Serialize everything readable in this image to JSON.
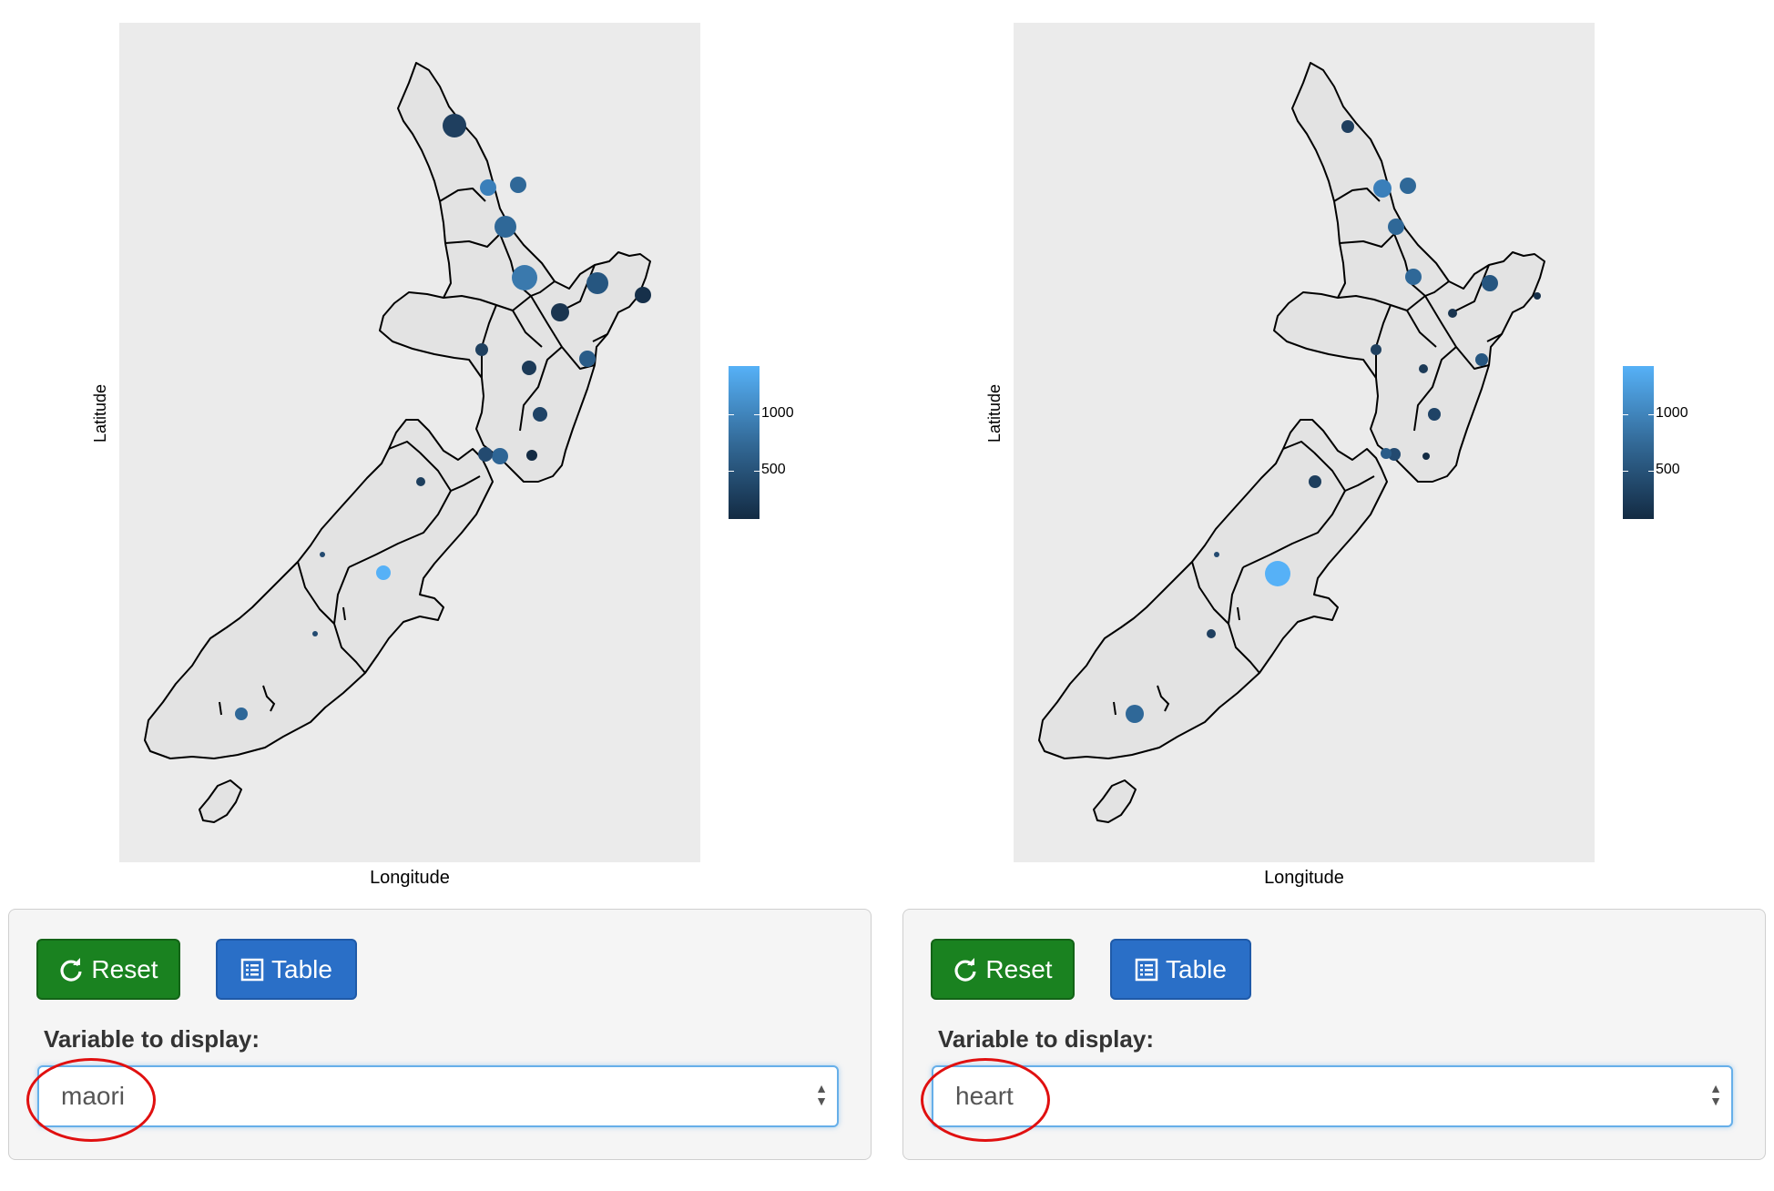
{
  "panels": [
    {
      "id": "left",
      "plot": {
        "xlabel": "Longitude",
        "ylabel": "Latitude",
        "legend_ticks": [
          "1000",
          "500"
        ],
        "legend_colors": {
          "high": "#56b1f7",
          "mid": "#336a98",
          "low": "#132b43"
        }
      },
      "controls": {
        "reset_label": "Reset",
        "table_label": "Table",
        "variable_label": "Variable to display:",
        "selected_variable": "maori"
      }
    },
    {
      "id": "right",
      "plot": {
        "xlabel": "Longitude",
        "ylabel": "Latitude",
        "legend_ticks": [
          "1000",
          "500"
        ],
        "legend_colors": {
          "high": "#56b1f7",
          "mid": "#336a98",
          "low": "#132b43"
        }
      },
      "controls": {
        "reset_label": "Reset",
        "table_label": "Table",
        "variable_label": "Variable to display:",
        "selected_variable": "heart"
      }
    }
  ],
  "colors": {
    "reset_button": "#1a8220",
    "table_button": "#2a6fc7",
    "annotation_circle": "#e01010",
    "panel_background": "#ebebeb"
  }
}
